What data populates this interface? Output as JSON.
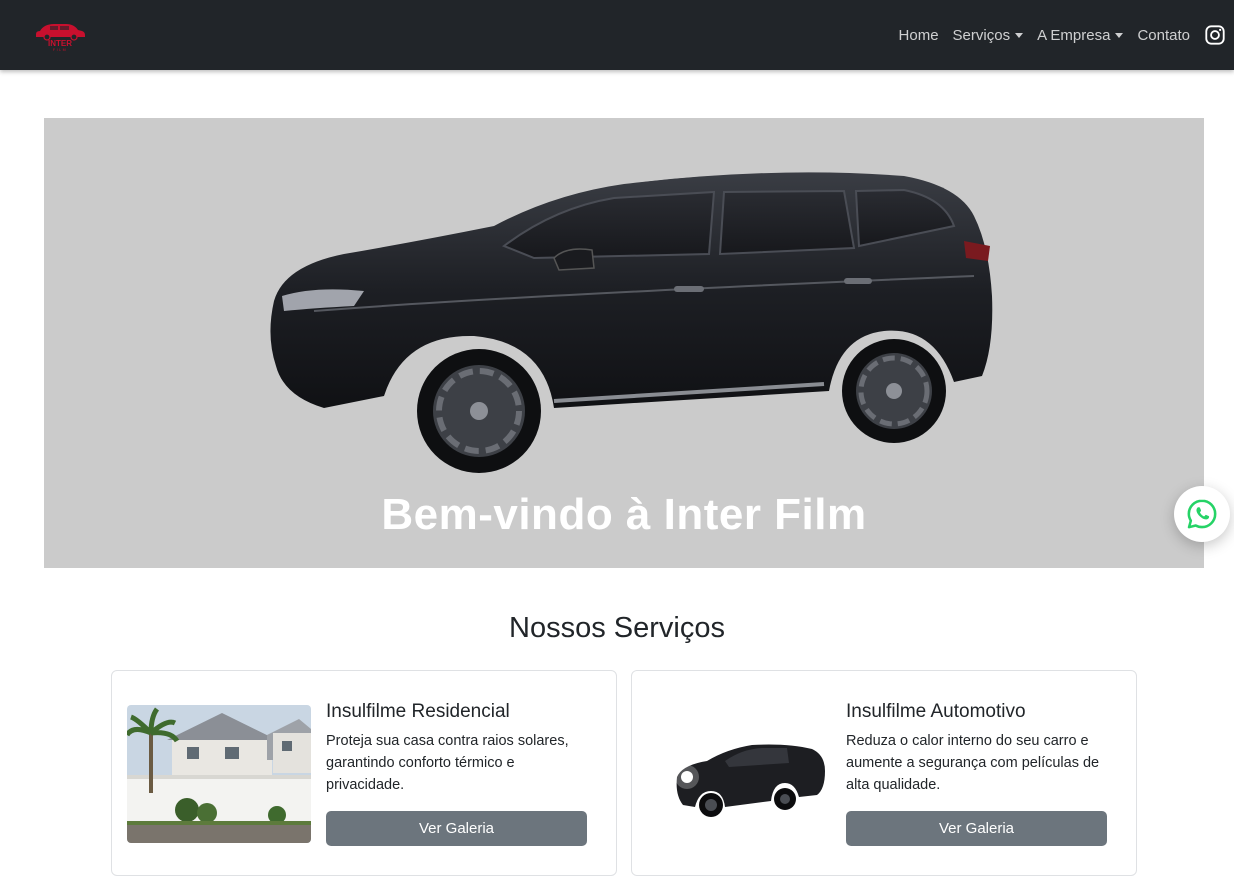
{
  "brand": {
    "logo_text": "INTER",
    "logo_subtext": "FILM",
    "logo_color": "#c8102e"
  },
  "nav": {
    "items": [
      {
        "label": "Home",
        "dropdown": false
      },
      {
        "label": "Serviços",
        "dropdown": true
      },
      {
        "label": "A Empresa",
        "dropdown": true
      },
      {
        "label": "Contato",
        "dropdown": false
      }
    ],
    "social_icon": "instagram-icon"
  },
  "hero": {
    "title": "Bem-vindo à Inter Film",
    "background": "#cbcbcb"
  },
  "floating": {
    "icon": "whatsapp-icon",
    "color": "#25d366"
  },
  "services": {
    "title": "Nossos Serviços",
    "cards": [
      {
        "title": "Insulfilme Residencial",
        "text": "Proteja sua casa contra raios solares, garantindo conforto térmico e privacidade.",
        "button": "Ver Galeria"
      },
      {
        "title": "Insulfilme Automotivo",
        "text": "Reduza o calor interno do seu carro e aumente a segurança com películas de alta qualidade.",
        "button": "Ver Galeria"
      }
    ]
  },
  "colors": {
    "navbar": "#212529",
    "button": "#6c757d"
  }
}
